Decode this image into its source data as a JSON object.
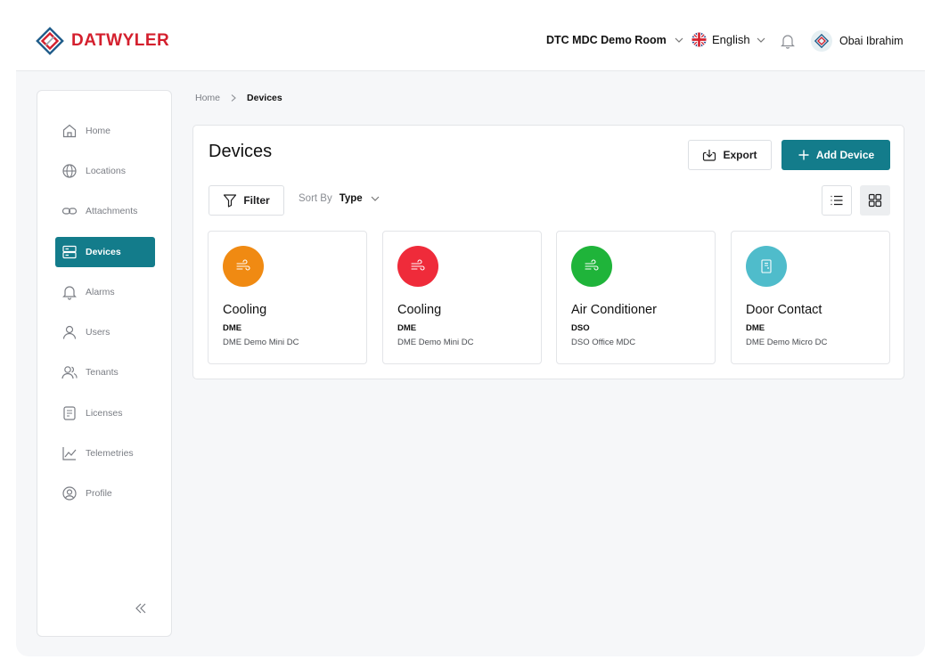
{
  "header": {
    "brand": "DATWYLER",
    "room": "DTC MDC Demo Room",
    "language": "English",
    "user_name": "Obai Ibrahim"
  },
  "sidebar": {
    "items": [
      {
        "label": "Home",
        "icon": "home-icon"
      },
      {
        "label": "Locations",
        "icon": "globe-icon"
      },
      {
        "label": "Attachments",
        "icon": "link-icon"
      },
      {
        "label": "Devices",
        "icon": "server-icon",
        "active": true
      },
      {
        "label": "Alarms",
        "icon": "bell-icon"
      },
      {
        "label": "Users",
        "icon": "user-icon"
      },
      {
        "label": "Tenants",
        "icon": "users-icon"
      },
      {
        "label": "Licenses",
        "icon": "license-icon"
      },
      {
        "label": "Telemetries",
        "icon": "chart-line-icon"
      },
      {
        "label": "Profile",
        "icon": "profile-icon"
      }
    ]
  },
  "breadcrumb": {
    "home": "Home",
    "current": "Devices"
  },
  "main": {
    "title": "Devices",
    "export_label": "Export",
    "add_label": "Add Device",
    "filter_label": "Filter",
    "sort_label": "Sort By",
    "sort_value": "Type"
  },
  "devices": [
    {
      "name": "Cooling",
      "code": "DME",
      "site": "DME Demo Mini DC",
      "color": "#f08a12",
      "icon": "wind-icon"
    },
    {
      "name": "Cooling",
      "code": "DME",
      "site": "DME Demo Mini DC",
      "color": "#ef2b3a",
      "icon": "wind-icon"
    },
    {
      "name": "Air Conditioner",
      "code": "DSO",
      "site": "DSO Office MDC",
      "color": "#1fb43a",
      "icon": "wind-icon"
    },
    {
      "name": "Door Contact",
      "code": "DME",
      "site": "DME Demo Micro DC",
      "color": "#4fbccb",
      "icon": "door-icon"
    }
  ],
  "colors": {
    "brand_red": "#d4202e",
    "accent_teal": "#137c8b"
  }
}
